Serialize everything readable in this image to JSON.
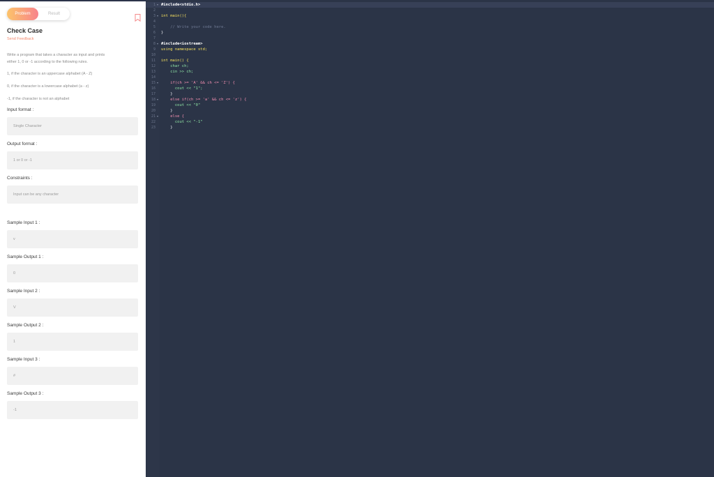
{
  "tabs": {
    "problem": "Problem",
    "result": "Result"
  },
  "problem": {
    "title": "Check Case",
    "feedback": "Send Feedback",
    "description": [
      "Write a program that takes a character as input and prints",
      "either 1, 0 or -1 according to the following rules.",
      "1, if the character is an uppercase alphabet (A - Z)",
      "0, if the character is a lowercase alphabet (a - z)",
      "-1, if the character is not an alphabet"
    ],
    "input_format_label": "Input format :",
    "input_format": "Single Character",
    "output_format_label": "Output format :",
    "output_format": "1 or 0 or -1",
    "constraints_label": "Constraints :",
    "constraints": "Input can be any character",
    "samples": [
      {
        "label": "Sample Input 1 :",
        "value": "v"
      },
      {
        "label": "Sample Output 1 :",
        "value": "0"
      },
      {
        "label": "Sample Input 2 :",
        "value": "V"
      },
      {
        "label": "Sample Output 2 :",
        "value": "1"
      },
      {
        "label": "Sample Input 3 :",
        "value": "#"
      },
      {
        "label": "Sample Output 3 :",
        "value": "-1"
      }
    ]
  },
  "editor": {
    "line_numbers": [
      "1",
      "2",
      "3",
      "4",
      "5",
      "6",
      "7",
      "8",
      "9",
      "10",
      "11",
      "12",
      "13",
      "14",
      "15",
      "16",
      "17",
      "18",
      "19",
      "20",
      "21",
      "22",
      "23"
    ],
    "lines": [
      "#include<stdio.h>",
      "",
      "int main(){",
      "",
      "    // Write your code here.",
      "",
      "}",
      "",
      "#include<iostream>",
      "using namespace std;",
      "",
      "int main() {",
      "    char ch;",
      "    cin >> ch;",
      "",
      "    if(ch >= 'A' && ch <= 'Z') {",
      "      cout << \"1\";",
      "    }",
      "    else if(ch >= 'a' && ch <= 'z') {",
      "      cout << \"0\"",
      "    }",
      "    else {",
      "      cout << \"-1\"",
      "    }"
    ],
    "colors": {
      "background": "#2b3447",
      "keyword": "#f6e05e",
      "type": "#8fe3a4",
      "string": "#fbe3a4",
      "comment": "#6f7a94"
    }
  },
  "colors": {
    "accent_start": "#fcc36a",
    "accent_end": "#f8838c",
    "feedback": "#f48a6f"
  }
}
